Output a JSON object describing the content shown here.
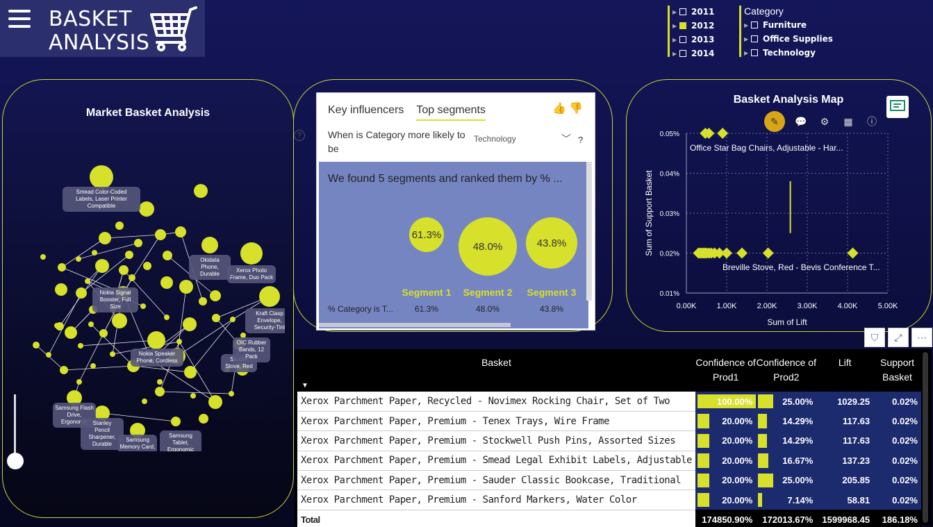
{
  "header": {
    "title_line1": "BASKET",
    "title_line2": "ANALYSIS"
  },
  "year_slicer": {
    "items": [
      {
        "label": "2011",
        "checked": false
      },
      {
        "label": "2012",
        "checked": true
      },
      {
        "label": "2013",
        "checked": false
      },
      {
        "label": "2014",
        "checked": false
      }
    ]
  },
  "category_slicer": {
    "title": "Category",
    "items": [
      {
        "label": "Furniture",
        "checked": false
      },
      {
        "label": "Office Supplies",
        "checked": false
      },
      {
        "label": "Technology",
        "checked": false
      }
    ]
  },
  "market_basket": {
    "title": "Market Basket Analysis",
    "node_labels": [
      "Smead Color-Coded Labels, Laser Printer Compatible",
      "Xerox Photo Frame, Duo Pack",
      "Kraft Clasp Envelope, Security-Tint",
      "Okidata Phone, Durable",
      "Nokia Signal Booster, Full Size",
      "Nokia Speaker Phone, Cordless",
      "Samsung Flash Drive, Ergonomic",
      "Stanley Pencil Sharpener, Durable",
      "Samsung Memory Card, USB",
      "Sauder Stove, Red",
      "OIC Rubber Bands, 12 Pack",
      "Samsung Tablet, Ergonomic"
    ]
  },
  "key_influencers": {
    "tab1": "Key influencers",
    "tab2": "Top segments",
    "question": "When is Category more likely to be",
    "selected_value": "Technology",
    "help": "?",
    "found_text": "We found 5 segments and ranked them by % ...",
    "row_label": "% Category is T...",
    "segments": [
      {
        "label": "Segment 1",
        "value": "61.3%"
      },
      {
        "label": "Segment 2",
        "value": "48.0%"
      },
      {
        "label": "Segment 3",
        "value": "43.8%"
      }
    ]
  },
  "map": {
    "title": "Basket Analysis Map",
    "xlabel": "Sum of Lift",
    "ylabel": "Sum of Support Basket",
    "annotation_top": "Office Star Bag Chairs, Adjustable - Har...",
    "annotation_bottom": "Breville Stove, Red - Bevis Conference T...",
    "x_ticks": [
      "0.00K",
      "1.00K",
      "2.00K",
      "3.00K",
      "4.00K",
      "5.00K"
    ],
    "y_ticks": [
      "0.05%",
      "0.04%",
      "0.03%",
      "0.02%",
      "0.01%"
    ]
  },
  "chart_data": {
    "type": "scatter",
    "title": "Basket Analysis Map",
    "xlabel": "Sum of Lift",
    "ylabel": "Sum of Support Basket",
    "xlim": [
      0,
      5000
    ],
    "ylim": [
      0.0001,
      0.0005
    ],
    "points": [
      {
        "x": 470,
        "y": 0.0005
      },
      {
        "x": 560,
        "y": 0.0005
      },
      {
        "x": 900,
        "y": 0.0005
      },
      {
        "x": 300,
        "y": 0.0002
      },
      {
        "x": 340,
        "y": 0.0002
      },
      {
        "x": 380,
        "y": 0.0002
      },
      {
        "x": 420,
        "y": 0.0002
      },
      {
        "x": 460,
        "y": 0.0002
      },
      {
        "x": 500,
        "y": 0.0002
      },
      {
        "x": 560,
        "y": 0.0002
      },
      {
        "x": 620,
        "y": 0.0002
      },
      {
        "x": 700,
        "y": 0.0002
      },
      {
        "x": 820,
        "y": 0.0002
      },
      {
        "x": 1000,
        "y": 0.0002
      },
      {
        "x": 1380,
        "y": 0.0002
      },
      {
        "x": 2030,
        "y": 0.0002
      },
      {
        "x": 4130,
        "y": 0.0002
      }
    ]
  },
  "table": {
    "headers": [
      "Basket",
      "Confidence of Prod1",
      "Confidence of Prod2",
      "Lift",
      "Support Basket"
    ],
    "rows": [
      {
        "basket": "Xerox Parchment Paper, Recycled - Novimex Rocking Chair, Set of Two",
        "c1": "100.00%",
        "c1f": 1.0,
        "c2": "25.00%",
        "c2f": 0.25,
        "lift": "1029.25",
        "support": "0.02%"
      },
      {
        "basket": "Xerox Parchment Paper, Premium - Tenex Trays, Wire Frame",
        "c1": "20.00%",
        "c1f": 0.2,
        "c2": "14.29%",
        "c2f": 0.1429,
        "lift": "117.63",
        "support": "0.02%"
      },
      {
        "basket": "Xerox Parchment Paper, Premium - Stockwell Push Pins, Assorted Sizes",
        "c1": "20.00%",
        "c1f": 0.2,
        "c2": "14.29%",
        "c2f": 0.1429,
        "lift": "117.63",
        "support": "0.02%"
      },
      {
        "basket": "Xerox Parchment Paper, Premium - Smead Legal Exhibit Labels, Adjustable",
        "c1": "20.00%",
        "c1f": 0.2,
        "c2": "16.67%",
        "c2f": 0.1667,
        "lift": "137.23",
        "support": "0.02%"
      },
      {
        "basket": "Xerox Parchment Paper, Premium - Sauder Classic Bookcase, Traditional",
        "c1": "20.00%",
        "c1f": 0.2,
        "c2": "25.00%",
        "c2f": 0.25,
        "lift": "205.85",
        "support": "0.02%"
      },
      {
        "basket": "Xerox Parchment Paper, Premium - Sanford Markers, Water Color",
        "c1": "20.00%",
        "c1f": 0.2,
        "c2": "7.14%",
        "c2f": 0.0714,
        "lift": "58.81",
        "support": "0.02%"
      }
    ],
    "total": {
      "label": "Total",
      "c1": "174850.90%",
      "c2": "172013.67%",
      "lift": "1599968.45",
      "support": "186.18%"
    }
  },
  "colors": {
    "accent": "#d7e02a",
    "background": "#14165a",
    "segment_bg": "#7585c2",
    "table_cell": "#1c2a6e"
  }
}
